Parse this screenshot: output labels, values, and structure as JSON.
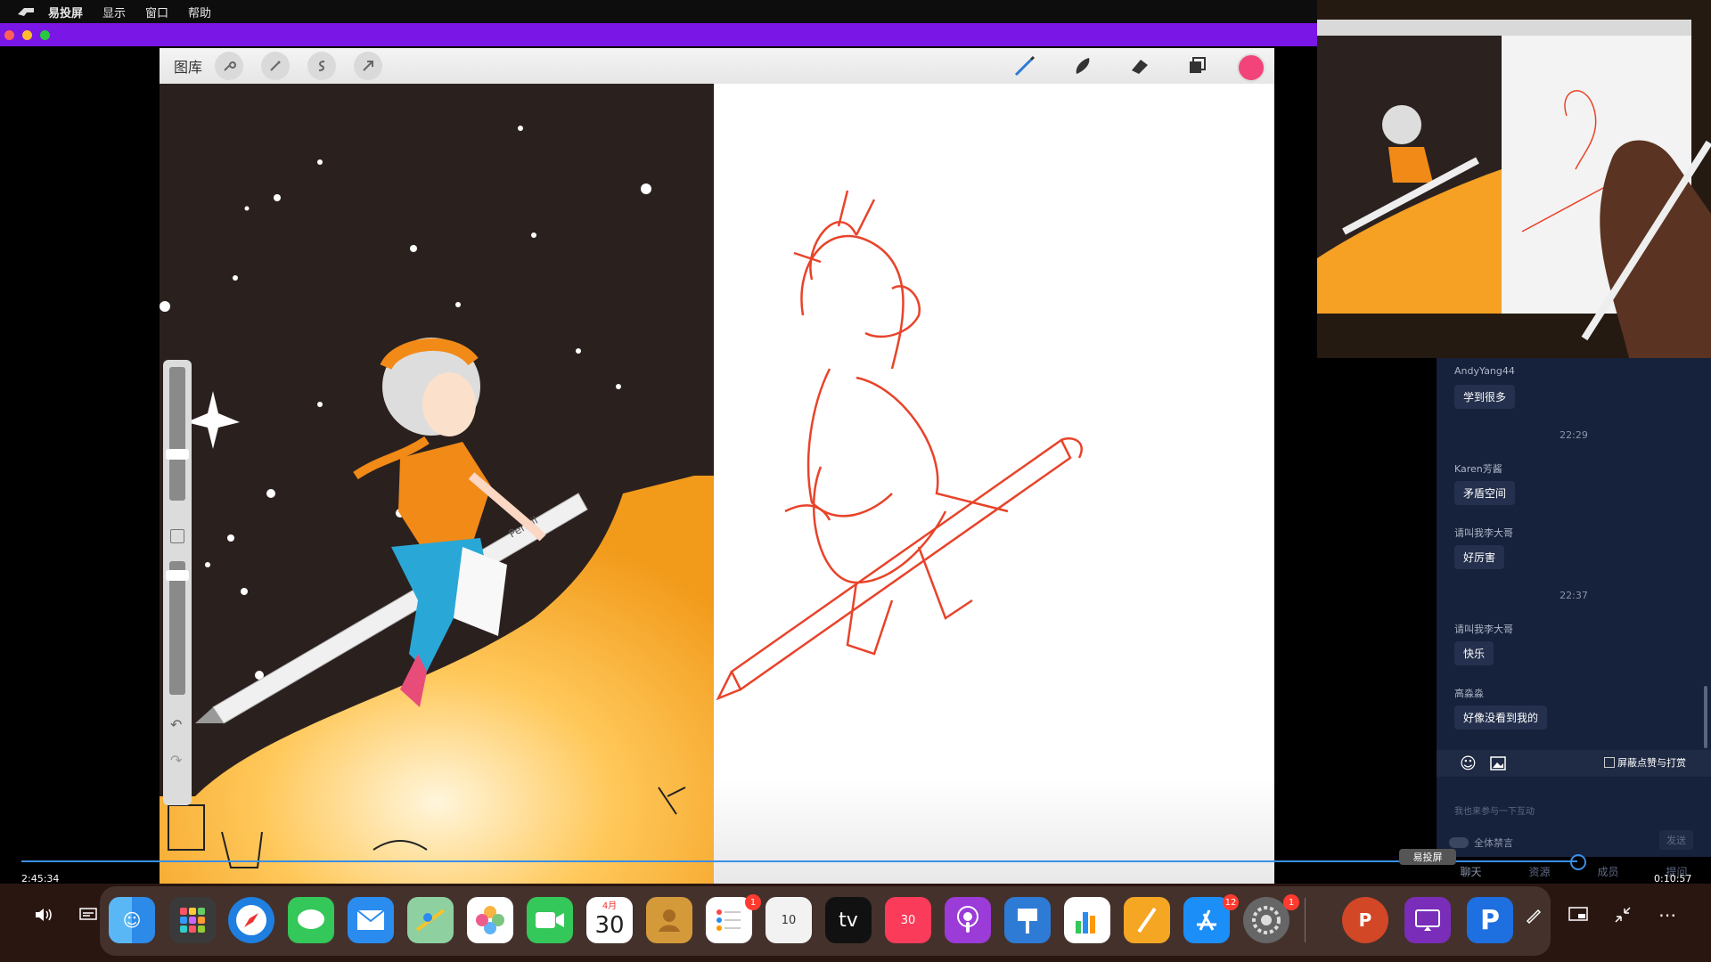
{
  "menubar": {
    "app_name": "易投屏",
    "items": [
      "显示",
      "窗口",
      "帮助"
    ]
  },
  "procreate": {
    "gallery_label": "图库",
    "left_tools": [
      "wrench-icon",
      "magic-wand-icon",
      "selection-icon",
      "transform-icon"
    ],
    "right_tools": [
      "brush-icon",
      "smudge-icon",
      "eraser-icon",
      "layers-icon"
    ],
    "current_color": "#f2447a",
    "pencil_brand": "Pencil"
  },
  "chat": {
    "messages": [
      {
        "user": "AndyYang44",
        "text": "学到很多"
      },
      {
        "time": "22:29"
      },
      {
        "user": "Karen芳酱",
        "text": "矛盾空间"
      },
      {
        "user": "请叫我李大哥",
        "text": "好厉害"
      },
      {
        "time": "22:37"
      },
      {
        "user": "请叫我李大哥",
        "text": "快乐"
      },
      {
        "user": "高淼淼",
        "text": "好像没看到我的"
      }
    ],
    "block_label": "屏蔽点赞与打赏",
    "input_placeholder": "我也来参与一下互动",
    "mute_all_label": "全体禁言",
    "send_label": "发送",
    "tabs": [
      "聊天",
      "资源",
      "成员",
      "提问"
    ]
  },
  "player": {
    "elapsed": "2:45:34",
    "remaining": "0:10:57",
    "progress": 0.828,
    "tooltip": "易投屏"
  },
  "dock": {
    "calendar_month": "4月",
    "calendar_day": "30",
    "reminders_badge": "1",
    "rewind_label": "10",
    "forward_label": "30",
    "appletv_label": "tv",
    "appstore_badge": "12",
    "settings_badge": "1",
    "powerpoint_letter": "P"
  },
  "colors": {
    "menubar_bg": "#0d0d0d",
    "window_bar": "#7a16e6",
    "chat_bg": "#16213b",
    "progress": "#3b8fe6",
    "sketch_red": "#e8432a"
  }
}
